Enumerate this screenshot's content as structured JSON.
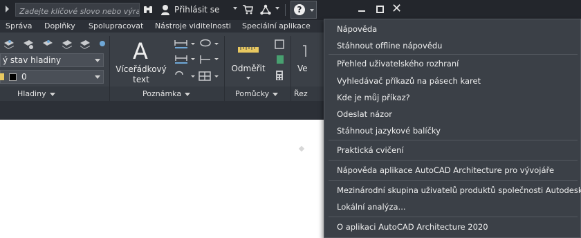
{
  "search": {
    "placeholder": "Zadejte klíčové slovo nebo výraz."
  },
  "header": {
    "signin_label": "Přihlásit se"
  },
  "tabs": [
    {
      "label": "Správa"
    },
    {
      "label": "Doplňky"
    },
    {
      "label": "Spolupracovat"
    },
    {
      "label": "Nástroje viditelnosti"
    },
    {
      "label": "Speciální aplikace"
    }
  ],
  "ribbon": {
    "layer_state": "ý stav hladiny",
    "layer_name": "0",
    "panels": {
      "hladiny": "Hladiny",
      "poznamka": "Poznámka",
      "pomucky": "Pomůcky",
      "rez": "Řez"
    },
    "buttons": {
      "multiline_text_1": "Víceřádkový",
      "multiline_text_2": "text",
      "measure": "Odměřit",
      "partial": "Ve"
    }
  },
  "help_menu": {
    "items": [
      {
        "label": "Nápověda"
      },
      {
        "label": "Stáhnout offline nápovědu"
      },
      {
        "label": "Přehled uživatelského rozhraní"
      },
      {
        "label": "Vyhledávač příkazů na pásech karet"
      },
      {
        "label": "Kde je můj příkaz?"
      },
      {
        "label": "Odeslat názor"
      },
      {
        "label": "Stáhnout jazykové balíčky"
      },
      {
        "label": "Praktická cvičení"
      },
      {
        "label": "Nápověda aplikace AutoCAD Architecture pro vývojáře"
      },
      {
        "label": "Mezinárodní skupina uživatelů produktů společnosti Autodesk"
      },
      {
        "label": "Lokální analýza..."
      },
      {
        "label": "O aplikaci AutoCAD Architecture 2020"
      }
    ]
  }
}
